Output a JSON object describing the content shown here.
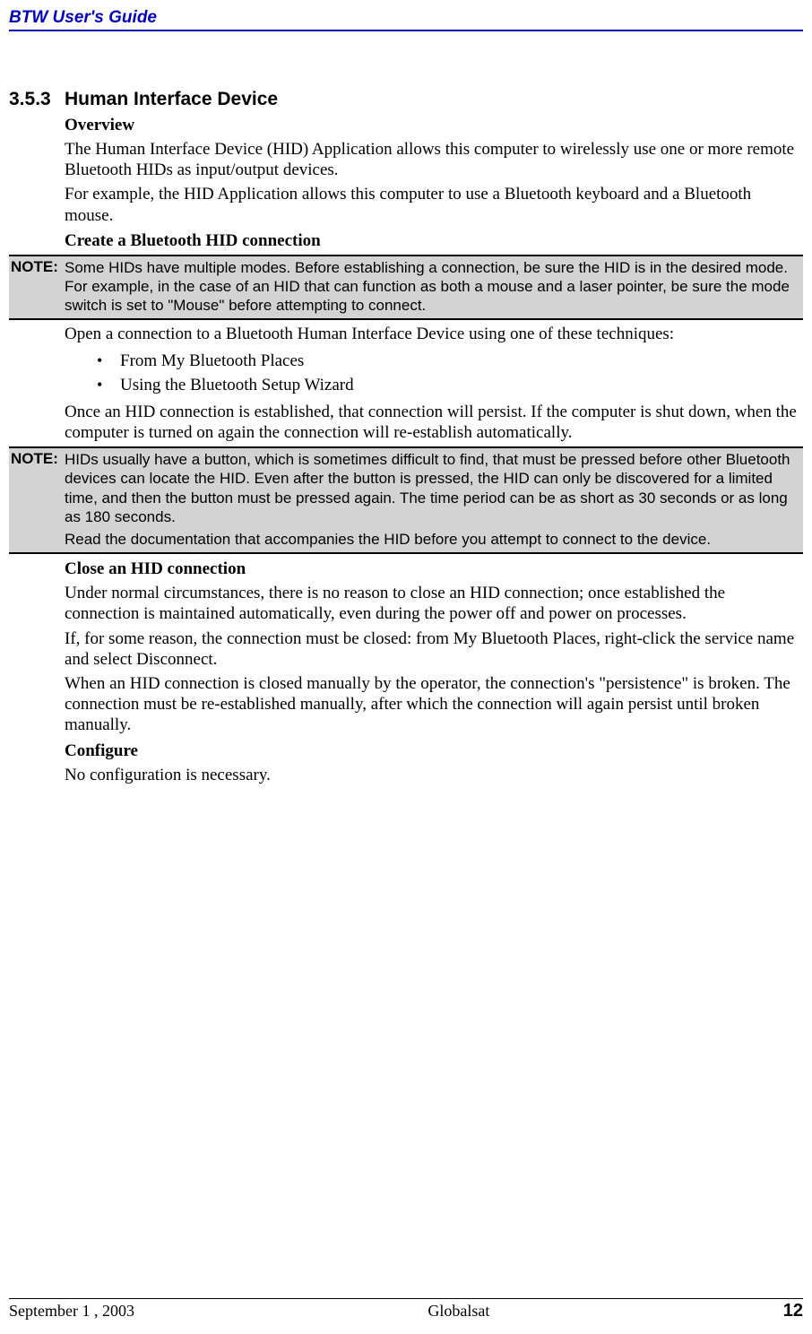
{
  "header": {
    "title": "BTW User's Guide"
  },
  "section": {
    "number": "3.5.3",
    "title": "Human Interface Device",
    "overview": {
      "heading": "Overview",
      "p1": "The Human Interface Device (HID) Application allows this computer to wirelessly use one or more remote Bluetooth HIDs as input/output devices.",
      "p2": "For example, the HID Application allows this computer to use a Bluetooth keyboard and a Bluetooth mouse."
    },
    "create": {
      "heading": "Create a Bluetooth HID connection"
    },
    "note1": {
      "label": "NOTE:",
      "text": "Some HIDs have multiple modes. Before establishing a connection, be sure the HID is in the desired mode. For example, in the case of an HID that can function as both a mouse and a laser pointer, be sure the mode switch is set to \"Mouse\" before attempting to connect."
    },
    "open_text": "Open a connection to a Bluetooth Human Interface Device using one of these techniques:",
    "bullets": [
      "From My Bluetooth Places",
      "Using the Bluetooth Setup Wizard"
    ],
    "persist_text": "Once an HID connection is established, that connection will persist. If the computer is shut down, when the computer is turned on again the connection will re-establish automatically.",
    "note2": {
      "label": "NOTE:",
      "text1": "HIDs usually have a button, which is sometimes difficult to find, that must be pressed before other Bluetooth devices can locate the HID. Even after the button is pressed, the HID can only be discovered for a limited time, and then the button must be pressed again. The time period can be as short as 30 seconds or as long as 180 seconds.",
      "text2": "Read the documentation that accompanies the HID before you attempt to connect to the device."
    },
    "close": {
      "heading": "Close an HID connection",
      "p1": "Under normal circumstances, there is no reason to close an HID connection; once established the connection is maintained automatically, even during the power off and power on processes.",
      "p2": "If, for some reason, the connection must be closed: from My Bluetooth Places, right-click the service name and select Disconnect.",
      "p3": "When an HID connection is closed manually by the operator, the connection's \"persistence\" is broken. The connection must be re-established manually, after which the connection will again persist until broken manually."
    },
    "configure": {
      "heading": "Configure",
      "p1": "No configuration is necessary."
    }
  },
  "footer": {
    "date": "September 1 , 2003",
    "center": "Globalsat",
    "page": "12"
  }
}
